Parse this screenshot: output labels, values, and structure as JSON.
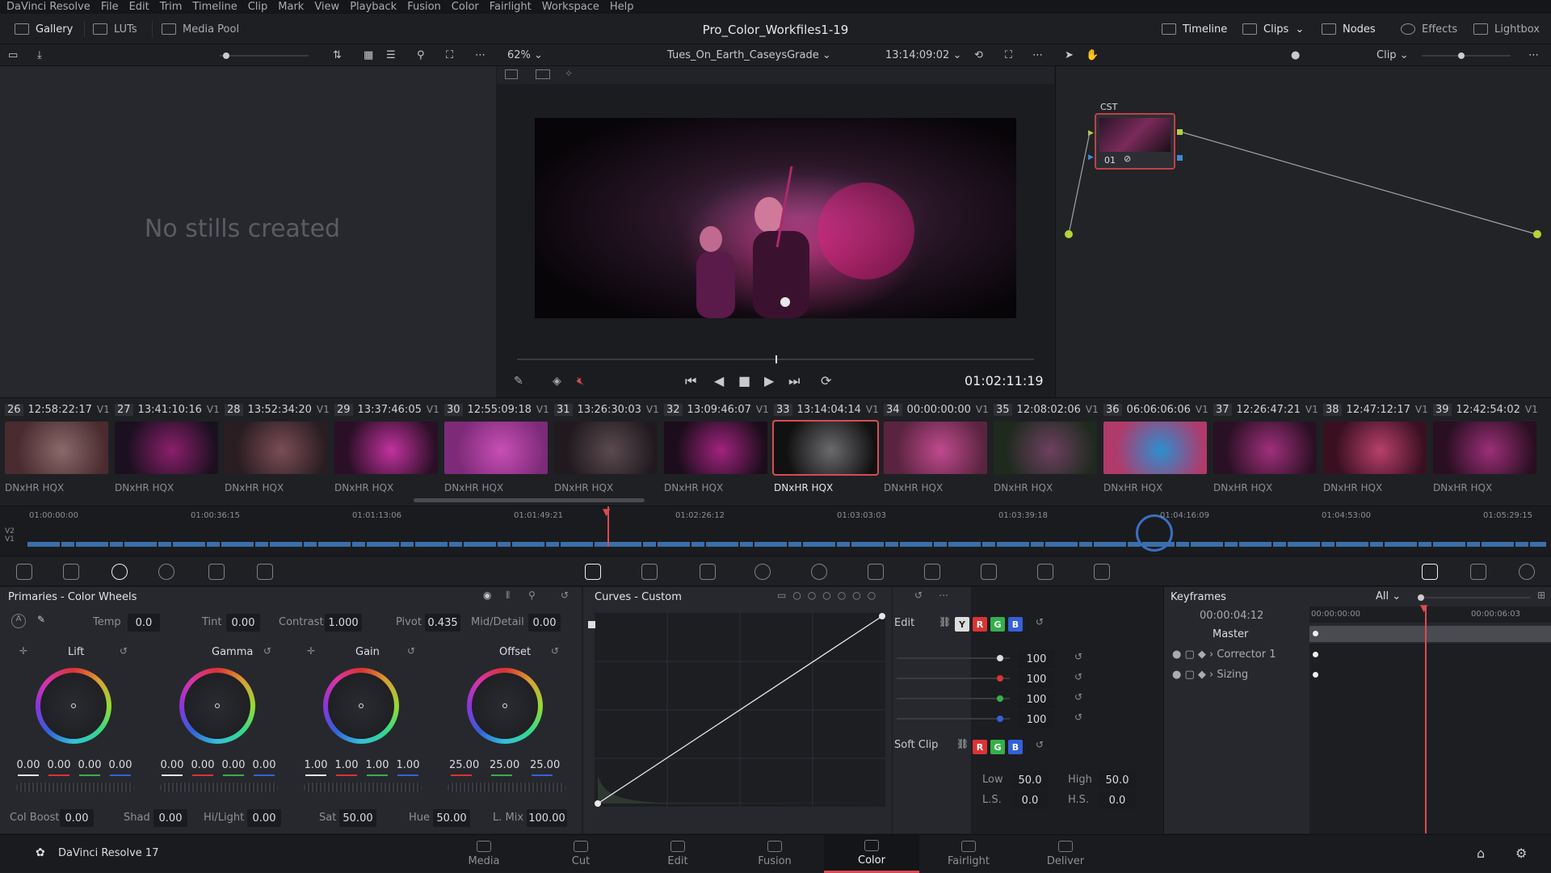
{
  "menu": [
    "DaVinci Resolve",
    "File",
    "Edit",
    "Trim",
    "Timeline",
    "Clip",
    "Mark",
    "View",
    "Playback",
    "Fusion",
    "Color",
    "Fairlight",
    "Workspace",
    "Help"
  ],
  "topbar": {
    "gallery": "Gallery",
    "luts": "LUTs",
    "media_pool": "Media Pool",
    "project_title": "Pro_Color_Workfiles1-19",
    "timeline": "Timeline",
    "clips": "Clips",
    "nodes": "Nodes",
    "effects": "Effects",
    "lightbox": "Lightbox"
  },
  "toolbar2": {
    "zoom": "62%",
    "timeline_name": "Tues_On_Earth_CaseysGrade",
    "timecode": "13:14:09:02",
    "mode": "Clip"
  },
  "gallery": {
    "empty_text": "No stills created"
  },
  "viewer": {
    "playback_timecode": "01:02:11:19"
  },
  "node": {
    "label": "CST",
    "number": "01"
  },
  "clips": [
    {
      "num": "26",
      "tc": "12:58:22:17",
      "track": "V1",
      "codec": "DNxHR HQX",
      "c1": "#4a2b2f",
      "c2": "#8a6a6a"
    },
    {
      "num": "27",
      "tc": "13:41:10:16",
      "track": "V1",
      "codec": "DNxHR HQX",
      "c1": "#1b1020",
      "c2": "#8b1f6b"
    },
    {
      "num": "28",
      "tc": "13:52:34:20",
      "track": "V1",
      "codec": "DNxHR HQX",
      "c1": "#2a1d22",
      "c2": "#7b4d55"
    },
    {
      "num": "29",
      "tc": "13:37:46:05",
      "track": "V1",
      "codec": "DNxHR HQX",
      "c1": "#2a0f26",
      "c2": "#c2329f"
    },
    {
      "num": "30",
      "tc": "12:55:09:18",
      "track": "V1",
      "codec": "DNxHR HQX",
      "c1": "#7d2a78",
      "c2": "#c74fb5"
    },
    {
      "num": "31",
      "tc": "13:26:30:03",
      "track": "V1",
      "codec": "DNxHR HQX",
      "c1": "#201a1e",
      "c2": "#5b4a50"
    },
    {
      "num": "32",
      "tc": "13:09:46:07",
      "track": "V1",
      "codec": "DNxHR HQX",
      "c1": "#1b0d1b",
      "c2": "#a1237f"
    },
    {
      "num": "33",
      "tc": "13:14:04:14",
      "track": "V1",
      "codec": "DNxHR HQX",
      "c1": "#111",
      "c2": "#6b6b6f"
    },
    {
      "num": "34",
      "tc": "00:00:00:00",
      "track": "V1",
      "codec": "DNxHR HQX",
      "c1": "#5a2440",
      "c2": "#c04a8e"
    },
    {
      "num": "35",
      "tc": "12:08:02:06",
      "track": "V1",
      "codec": "DNxHR HQX",
      "c1": "#1f2a1f",
      "c2": "#6e4060"
    },
    {
      "num": "36",
      "tc": "06:06:06:06",
      "track": "V1",
      "codec": "DNxHR HQX",
      "c1": "#b03a6a",
      "c2": "#2c8fd0"
    },
    {
      "num": "37",
      "tc": "12:26:47:21",
      "track": "V1",
      "codec": "DNxHR HQX",
      "c1": "#2a1024",
      "c2": "#a0307c"
    },
    {
      "num": "38",
      "tc": "12:47:12:17",
      "track": "V1",
      "codec": "DNxHR HQX",
      "c1": "#3a1020",
      "c2": "#b8406a"
    },
    {
      "num": "39",
      "tc": "12:42:54:02",
      "track": "V1",
      "codec": "DNxHR HQX",
      "c1": "#2a0f22",
      "c2": "#9c2f78"
    }
  ],
  "ruler": {
    "ticks": [
      "01:00:00:00",
      "01:00:36:15",
      "01:01:13:06",
      "01:01:49:21",
      "01:02:26:12",
      "01:03:03:03",
      "01:03:39:18",
      "01:04:16:09",
      "01:04:53:00",
      "01:05:29:15"
    ],
    "tracks": [
      "V2",
      "V1"
    ]
  },
  "primaries": {
    "title": "Primaries - Color Wheels",
    "temp_label": "Temp",
    "temp": "0.0",
    "tint_label": "Tint",
    "tint": "0.00",
    "contrast_label": "Contrast",
    "contrast": "1.000",
    "pivot_label": "Pivot",
    "pivot": "0.435",
    "middetail_label": "Mid/Detail",
    "middetail": "0.00",
    "wheels": [
      {
        "name": "Lift",
        "values": [
          "0.00",
          "0.00",
          "0.00",
          "0.00"
        ]
      },
      {
        "name": "Gamma",
        "values": [
          "0.00",
          "0.00",
          "0.00",
          "0.00"
        ]
      },
      {
        "name": "Gain",
        "values": [
          "1.00",
          "1.00",
          "1.00",
          "1.00"
        ]
      },
      {
        "name": "Offset",
        "values": [
          "25.00",
          "25.00",
          "25.00"
        ]
      }
    ],
    "colboost_label": "Col Boost",
    "colboost": "0.00",
    "shad_label": "Shad",
    "shad": "0.00",
    "hilight_label": "Hi/Light",
    "hilight": "0.00",
    "sat_label": "Sat",
    "sat": "50.00",
    "hue_label": "Hue",
    "hue": "50.00",
    "lmix_label": "L. Mix",
    "lmix": "100.00"
  },
  "curves": {
    "title": "Curves - Custom",
    "edit_label": "Edit",
    "values": [
      "100",
      "100",
      "100",
      "100"
    ],
    "softclip_label": "Soft Clip",
    "low_label": "Low",
    "low": "50.0",
    "high_label": "High",
    "high": "50.0",
    "ls_label": "L.S.",
    "ls": "0.0",
    "hs_label": "H.S.",
    "hs": "0.0",
    "y": "Y",
    "r": "R",
    "g": "G",
    "b": "B"
  },
  "keyframes": {
    "title": "Keyframes",
    "filter": "All",
    "timecode": "00:00:04:12",
    "ruler_start": "00:00:00:00",
    "ruler_end": "00:00:06:03",
    "rows": [
      "Master",
      "Corrector 1",
      "Sizing"
    ]
  },
  "bottom": {
    "app": "DaVinci Resolve 17",
    "pages": [
      "Media",
      "Cut",
      "Edit",
      "Fusion",
      "Color",
      "Fairlight",
      "Deliver"
    ],
    "active": "Color"
  },
  "colors": {
    "accent": "#d94b52",
    "panel": "#27282d"
  }
}
